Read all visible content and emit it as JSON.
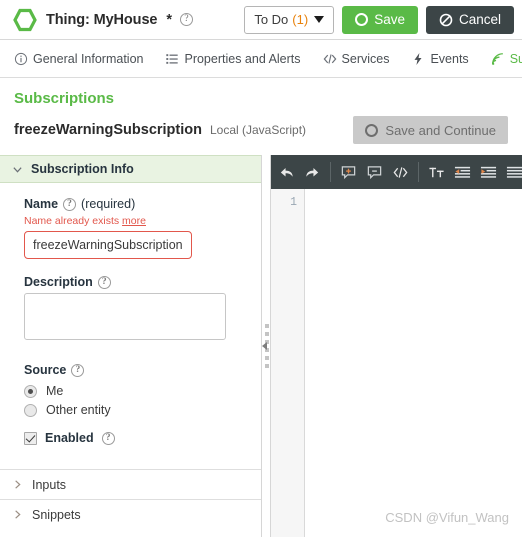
{
  "header": {
    "logo_icon": "hexagon-logo",
    "title": "Thing: MyHouse",
    "modified_marker": "*",
    "help_icon": "help-circle-icon",
    "todo_label": "To Do",
    "todo_count": "(1)",
    "save_label": "Save",
    "cancel_label": "Cancel",
    "save_color": "#5aba47",
    "cancel_color": "#3c4547"
  },
  "tabs": [
    {
      "label": "General Information",
      "icon": "info-circle-icon",
      "active": false
    },
    {
      "label": "Properties and Alerts",
      "icon": "list-icon",
      "active": false
    },
    {
      "label": "Services",
      "icon": "code-brackets-icon",
      "active": false
    },
    {
      "label": "Events",
      "icon": "lightning-bolt-icon",
      "active": false
    },
    {
      "label": "Sub",
      "icon": "signal-waves-icon",
      "active": true
    }
  ],
  "page": {
    "title": "Subscriptions",
    "title_color": "#5aba47",
    "entity_name": "freezeWarningSubscription",
    "entity_kind": "Local (JavaScript)",
    "save_continue_label": "Save and Continue",
    "save_continue_icon": "circle-icon"
  },
  "form": {
    "section_title": "Subscription Info",
    "section_chevron": "chevron-down-icon",
    "name": {
      "label": "Name",
      "help_icon": "help-circle-icon",
      "required_text": "(required)",
      "error_text": "Name already exists",
      "error_more": "more",
      "value": "freezeWarningSubscription",
      "error_color": "#e2574c"
    },
    "description": {
      "label": "Description",
      "help_icon": "help-circle-icon",
      "value": ""
    },
    "source": {
      "label": "Source",
      "help_icon": "help-circle-icon",
      "options": [
        {
          "label": "Me",
          "selected": true
        },
        {
          "label": "Other entity",
          "selected": false
        }
      ]
    },
    "enabled": {
      "label": "Enabled",
      "help_icon": "help-circle-icon",
      "checked": true
    },
    "collapsed_sections": [
      {
        "label": "Inputs",
        "chevron": "chevron-right-icon"
      },
      {
        "label": "Snippets",
        "chevron": "chevron-right-icon"
      }
    ]
  },
  "editor": {
    "toolbar_icons": [
      "undo-icon",
      "redo-icon",
      "add-comment-icon",
      "remove-comment-icon",
      "code-snippet-icon",
      "font-size-icon",
      "outdent-icon",
      "indent-icon",
      "list-lines-icon"
    ],
    "toolbar_bg": "#3c4547",
    "line_numbers": [
      "1"
    ],
    "code": "",
    "watermark": "CSDN @Vifun_Wang"
  }
}
